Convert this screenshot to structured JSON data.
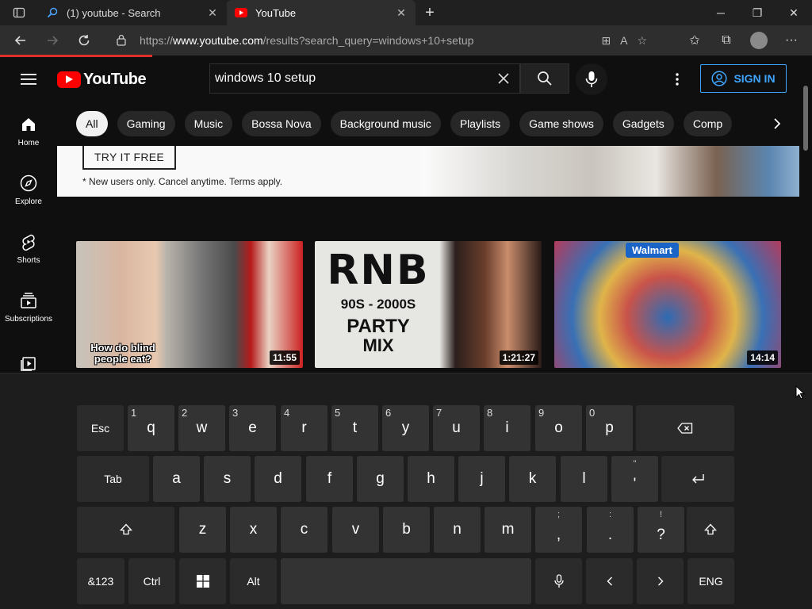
{
  "browser": {
    "tabs": [
      {
        "title": "(1) youtube - Search",
        "active": false
      },
      {
        "title": "YouTube",
        "active": true
      }
    ],
    "url_prefix": "https://",
    "url_host": "www.youtube.com",
    "url_path": "/results?search_query=windows+10+setup",
    "colors": {
      "loading_bar": "#e0302c"
    }
  },
  "header": {
    "logo_text": "YouTube",
    "search_value": "windows 10 setup",
    "signin_label": "SIGN IN",
    "accent": "#3ea6ff"
  },
  "sidebar": {
    "items": [
      {
        "label": "Home",
        "icon": "home-icon"
      },
      {
        "label": "Explore",
        "icon": "compass-icon"
      },
      {
        "label": "Shorts",
        "icon": "shorts-icon"
      },
      {
        "label": "Subscriptions",
        "icon": "subscriptions-icon"
      },
      {
        "label": "",
        "icon": "library-icon"
      }
    ]
  },
  "chips": [
    "All",
    "Gaming",
    "Music",
    "Bossa Nova",
    "Background music",
    "Playlists",
    "Game shows",
    "Gadgets",
    "Comp"
  ],
  "ad": {
    "button_label": "TRY IT FREE",
    "note": "* New users only. Cancel anytime. Terms apply."
  },
  "videos": [
    {
      "duration": "11:55",
      "caption": "How do blind people eat?"
    },
    {
      "duration": "1:21:27",
      "line1": "RNB",
      "line2": "90S - 2000S",
      "line3": "PARTY",
      "line4": "MIX"
    },
    {
      "duration": "14:14",
      "badge": "Walmart"
    }
  ],
  "keyboard": {
    "row1": [
      {
        "label": "Esc",
        "fn": true
      },
      {
        "label": "q",
        "hint": "1"
      },
      {
        "label": "w",
        "hint": "2"
      },
      {
        "label": "e",
        "hint": "3"
      },
      {
        "label": "r",
        "hint": "4"
      },
      {
        "label": "t",
        "hint": "5"
      },
      {
        "label": "y",
        "hint": "6"
      },
      {
        "label": "u",
        "hint": "7"
      },
      {
        "label": "i",
        "hint": "8"
      },
      {
        "label": "o",
        "hint": "9"
      },
      {
        "label": "p",
        "hint": "0"
      }
    ],
    "row2": [
      {
        "label": "Tab",
        "fn": true
      },
      {
        "label": "a"
      },
      {
        "label": "s"
      },
      {
        "label": "d"
      },
      {
        "label": "f"
      },
      {
        "label": "g"
      },
      {
        "label": "h"
      },
      {
        "label": "j"
      },
      {
        "label": "k"
      },
      {
        "label": "l"
      },
      {
        "label": "'",
        "hint": "\""
      }
    ],
    "row3": [
      {
        "label": "z"
      },
      {
        "label": "x"
      },
      {
        "label": "c"
      },
      {
        "label": "v"
      },
      {
        "label": "b"
      },
      {
        "label": "n"
      },
      {
        "label": "m"
      },
      {
        "label": ",",
        "hint": ";"
      },
      {
        "label": ".",
        "hint": ":"
      },
      {
        "label": "?",
        "hint": "!"
      }
    ],
    "row4": [
      {
        "label": "&123"
      },
      {
        "label": "Ctrl"
      },
      {
        "label": "Alt"
      },
      {
        "label": "ENG"
      }
    ]
  }
}
